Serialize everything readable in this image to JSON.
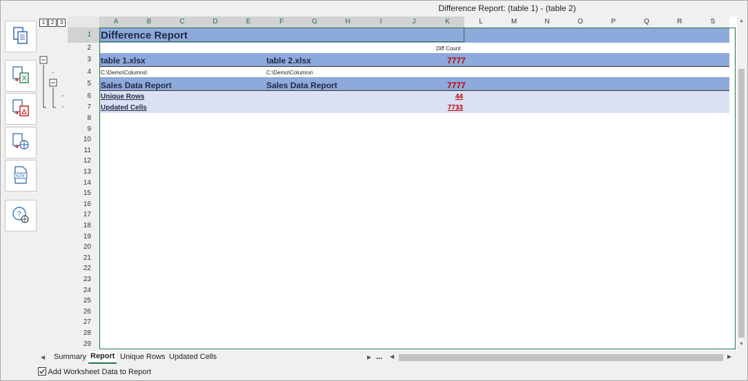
{
  "window": {
    "title": "Difference Report: (table 1) - (table 2)"
  },
  "outline_levels": [
    "1",
    "2",
    "3"
  ],
  "toolbar": {
    "buttons": [
      {
        "name": "copy-icon"
      },
      {
        "name": "export-excel-icon"
      },
      {
        "name": "export-pdf-icon"
      },
      {
        "name": "export-web-icon"
      },
      {
        "name": "export-xml-icon"
      },
      {
        "name": "help-web-icon"
      }
    ]
  },
  "columns": [
    "A",
    "B",
    "C",
    "D",
    "E",
    "F",
    "G",
    "H",
    "I",
    "J",
    "K",
    "L",
    "M",
    "N",
    "O",
    "P",
    "Q",
    "R",
    "S"
  ],
  "rows": [
    "1",
    "2",
    "3",
    "4",
    "5",
    "6",
    "7",
    "8",
    "9",
    "10",
    "11",
    "12",
    "13",
    "14",
    "15",
    "16",
    "17",
    "18",
    "19",
    "20",
    "21",
    "22",
    "23",
    "24",
    "25",
    "26",
    "27",
    "28",
    "29"
  ],
  "report": {
    "title": "Difference Report",
    "diff_count_label": "Diff Count",
    "left_file": "table 1.xlsx",
    "right_file": "table 2.xlsx",
    "left_path": "C:\\Demo\\Columns\\",
    "right_path": "C:\\Demo\\Columns\\",
    "file_count": "7777",
    "left_sheet": "Sales Data Report",
    "right_sheet": "Sales Data Report",
    "sheet_count": "7777",
    "unique_rows_label": "Unique Rows",
    "unique_rows_count": "44",
    "updated_cells_label": "Updated Cells",
    "updated_cells_count": "7733"
  },
  "sheet_tabs": [
    "Summary",
    "Report",
    "Unique Rows",
    "Updated Cells"
  ],
  "active_tab": "Report",
  "tab_more": "...",
  "checkbox": {
    "label": "Add Worksheet Data to Report",
    "checked": true
  },
  "colors": {
    "band_dark": "#8ea9db",
    "band_light": "#dae1f3",
    "count_red": "#c00000",
    "select_green": "#217346"
  }
}
